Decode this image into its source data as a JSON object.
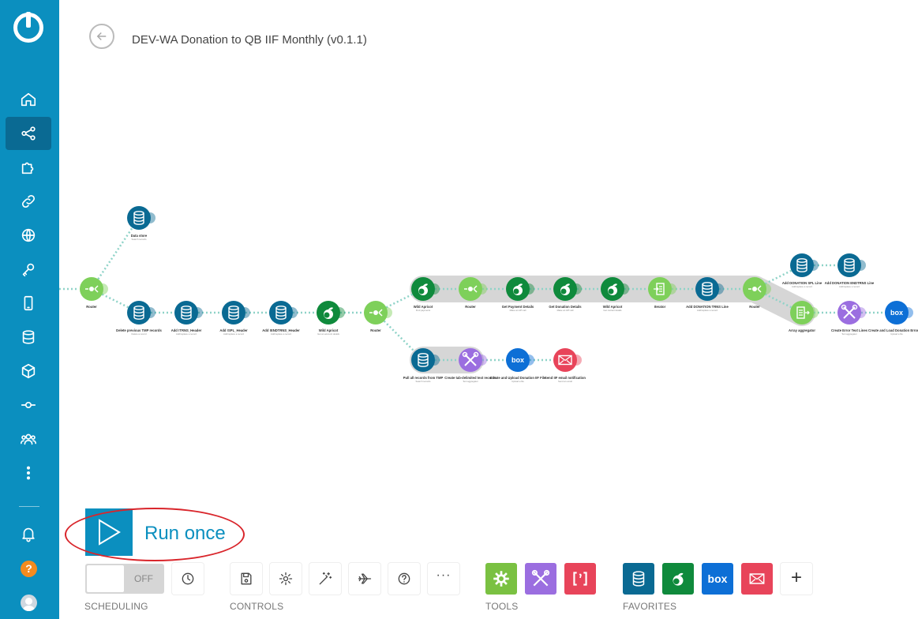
{
  "header": {
    "title": "DEV-WA Donation to QB IIF Monthly (v0.1.1)"
  },
  "sidebar": {
    "items": [
      {
        "icon": "home-icon"
      },
      {
        "icon": "share-icon"
      },
      {
        "icon": "puzzle-icon"
      },
      {
        "icon": "link-icon"
      },
      {
        "icon": "globe-icon"
      },
      {
        "icon": "key-icon"
      },
      {
        "icon": "mobile-icon"
      },
      {
        "icon": "database-icon"
      },
      {
        "icon": "cube-icon"
      },
      {
        "icon": "flow-icon"
      },
      {
        "icon": "team-icon"
      },
      {
        "icon": "more-icon"
      }
    ],
    "help": "?"
  },
  "run": {
    "label": "Run once"
  },
  "scheduling": {
    "toggle": "OFF",
    "label": "SCHEDULING"
  },
  "controls": {
    "label": "CONTROLS"
  },
  "tools": {
    "label": "TOOLS"
  },
  "favorites": {
    "label": "FAVORITES",
    "box": "box"
  },
  "flow": {
    "modules": [
      {
        "label": "Data store",
        "sub": "Search records"
      },
      {
        "label": "Router",
        "sub": ""
      },
      {
        "label": "Delete previous TMP records",
        "sub": "Delete a record"
      },
      {
        "label": "Add !TRNS_Header",
        "sub": "Add/replace a record"
      },
      {
        "label": "Add !SPL_Header",
        "sub": "Add/replace a record"
      },
      {
        "label": "Add !ENDTRNS_Header",
        "sub": "Add/replace a record"
      },
      {
        "label": "Wild Apricot",
        "sub": "Get an account details"
      },
      {
        "label": "Router",
        "sub": ""
      },
      {
        "label": "Wild Apricot",
        "sub": "Find payments"
      },
      {
        "label": "Router",
        "sub": ""
      },
      {
        "label": "Get Payment Details",
        "sub": "Make an API call"
      },
      {
        "label": "Get Donation Details",
        "sub": "Make an API call"
      },
      {
        "label": "Wild Apricot",
        "sub": "Get contact details"
      },
      {
        "label": "Iterator",
        "sub": ""
      },
      {
        "label": "Add DONATION TRNS Line",
        "sub": "Add/replace a record"
      },
      {
        "label": "Router",
        "sub": ""
      },
      {
        "label": "Add DONATION SPL Line",
        "sub": "Add/replace a record"
      },
      {
        "label": "Add DONATION ENDTRNS Line",
        "sub": "Add/replace a record"
      },
      {
        "label": "Array aggregator",
        "sub": ""
      },
      {
        "label": "Create Error Text Lines",
        "sub": "Text aggregator"
      },
      {
        "label": "Create and Load Donation Error File",
        "sub": "Upload a file"
      },
      {
        "label": "Pull all records from TMP",
        "sub": "Search records"
      },
      {
        "label": "Create tab-delimited text records",
        "sub": "Text aggregator"
      },
      {
        "label": "Create and Upload Donation IIF File",
        "sub": "Upload a file"
      },
      {
        "label": "Send IIF email notification",
        "sub": "Send an email"
      }
    ],
    "colors": {
      "datastore": "#0a6a93",
      "router": "#7ed05a",
      "apricot": "#0f8a3c",
      "iterator": "#7ed05a",
      "tools": "#9b6ee0",
      "box": "#0d6fd6",
      "email": "#e8445a"
    }
  }
}
